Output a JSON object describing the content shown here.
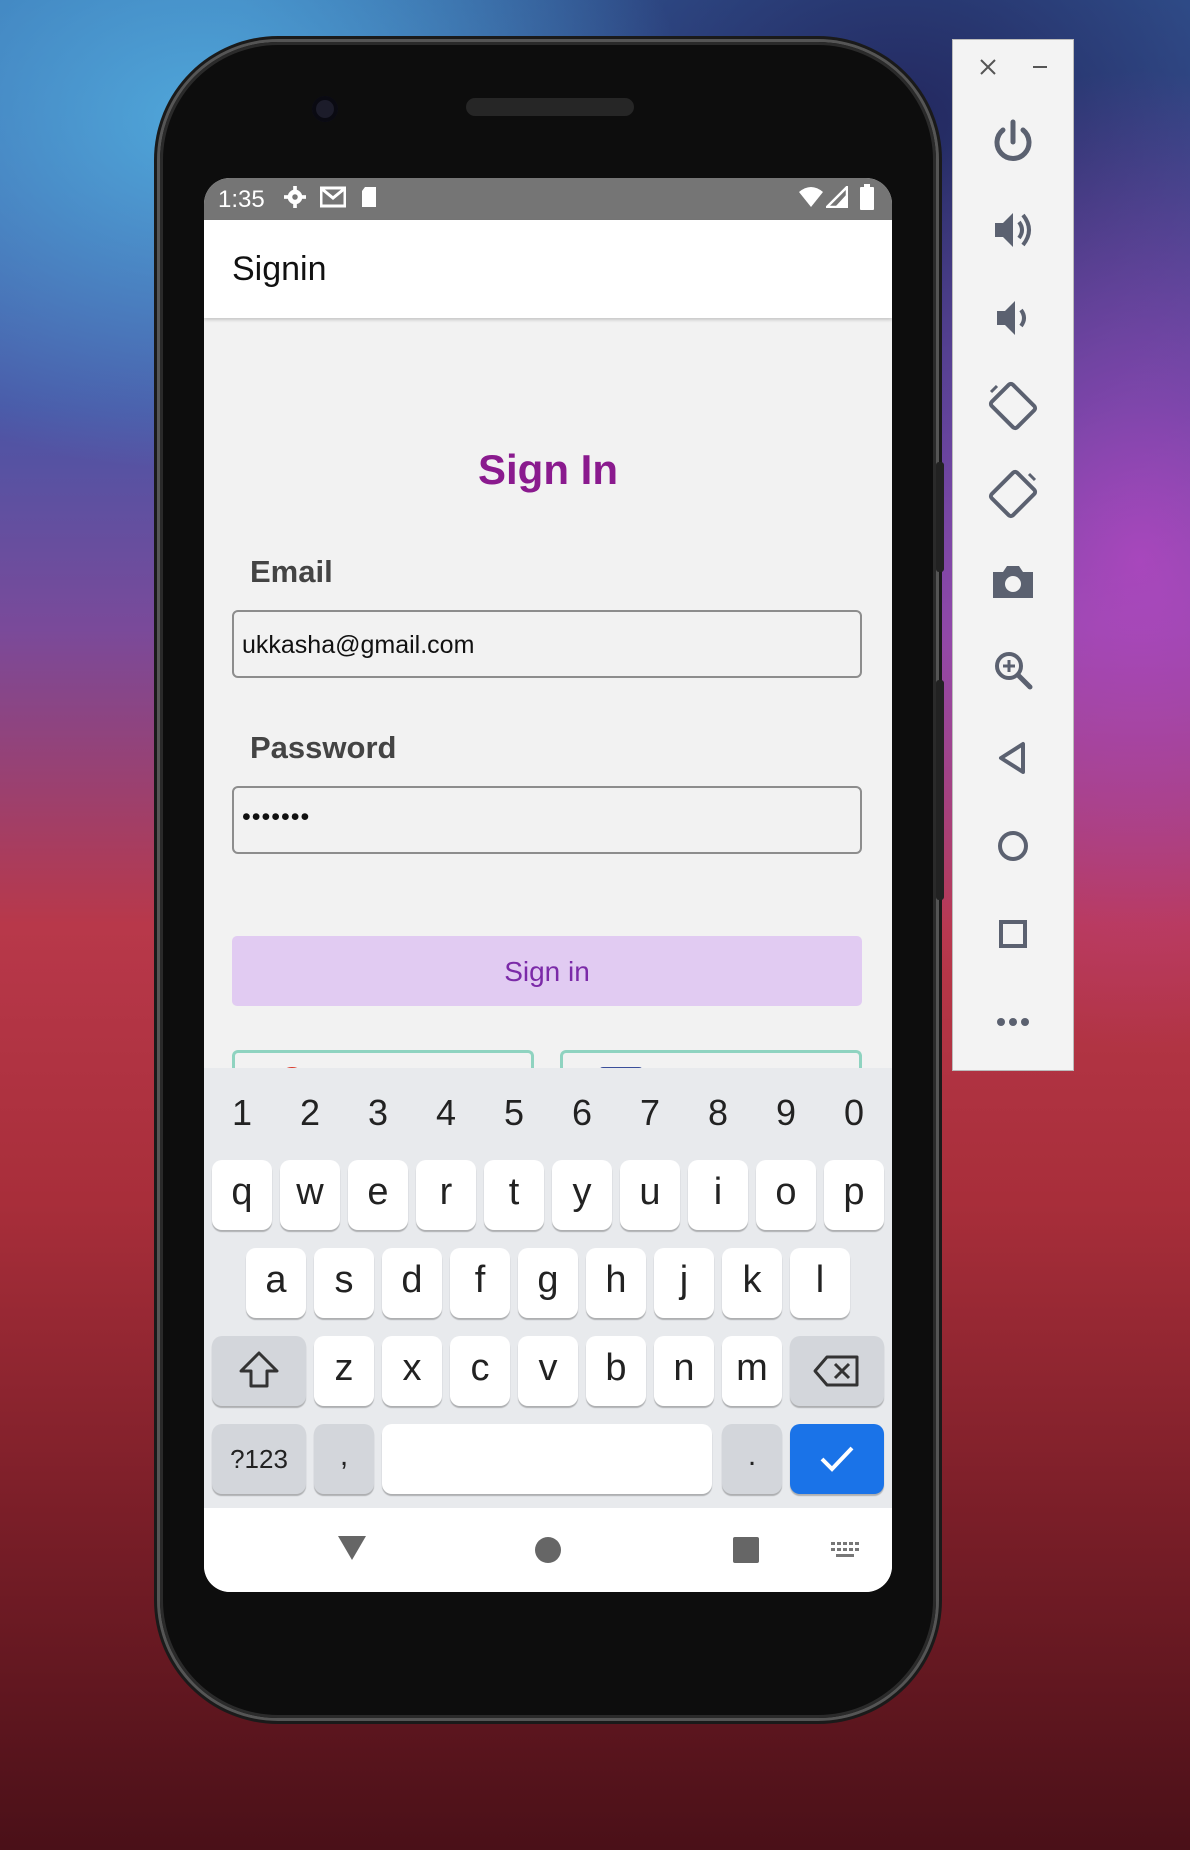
{
  "statusbar": {
    "time": "1:35",
    "left_icons": [
      "gear-icon",
      "gmail-icon",
      "sd-card-icon"
    ],
    "right_icons": [
      "wifi-icon",
      "cell-signal-icon",
      "battery-icon"
    ]
  },
  "appbar": {
    "title": "Signin"
  },
  "form": {
    "heading": "Sign In",
    "email_label": "Email",
    "email_value": "ukkasha@gmail.com",
    "password_label": "Password",
    "password_value": "•••••••",
    "submit_label": "Sign in",
    "social_buttons": [
      "google-icon",
      "facebook-icon"
    ]
  },
  "keyboard": {
    "numbers": [
      "1",
      "2",
      "3",
      "4",
      "5",
      "6",
      "7",
      "8",
      "9",
      "0"
    ],
    "row1": [
      "q",
      "w",
      "e",
      "r",
      "t",
      "y",
      "u",
      "i",
      "o",
      "p"
    ],
    "row2": [
      "a",
      "s",
      "d",
      "f",
      "g",
      "h",
      "j",
      "k",
      "l"
    ],
    "row3": [
      "z",
      "x",
      "c",
      "v",
      "b",
      "n",
      "m"
    ],
    "symbols_label": "?123",
    "comma_label": ",",
    "period_label": "."
  },
  "emulator_panel": {
    "controls": [
      "close-icon",
      "minimize-icon"
    ],
    "buttons": [
      "power-icon",
      "volume-up-icon",
      "volume-down-icon",
      "rotate-left-icon",
      "rotate-right-icon",
      "camera-icon",
      "zoom-icon",
      "back-icon",
      "home-icon",
      "overview-icon",
      "more-icon"
    ]
  },
  "colors": {
    "heading": "#8a1a8e",
    "button_bg": "#e1cbf2",
    "button_text": "#7b2aa8",
    "keyboard_done": "#1a73e8"
  }
}
